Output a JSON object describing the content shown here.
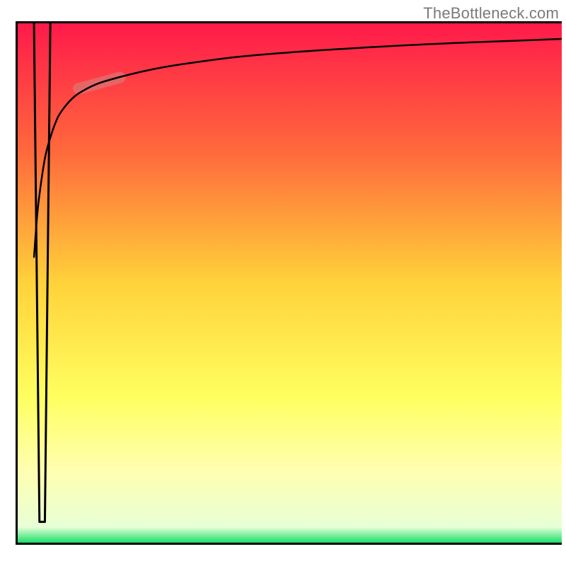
{
  "attribution": "TheBottleneck.com",
  "chart_data": {
    "type": "line",
    "title": "",
    "xlabel": "",
    "ylabel": "",
    "x_range": [
      0,
      100
    ],
    "y_range": [
      0,
      100
    ],
    "axes_visible": false,
    "grid": false,
    "background_gradient": {
      "type": "vertical",
      "stops": [
        {
          "t": 0.0,
          "color": "#ff1a4a"
        },
        {
          "t": 0.25,
          "color": "#ff6a3c"
        },
        {
          "t": 0.5,
          "color": "#ffd23a"
        },
        {
          "t": 0.72,
          "color": "#ffff60"
        },
        {
          "t": 0.86,
          "color": "#ffffb0"
        },
        {
          "t": 0.97,
          "color": "#e8ffd6"
        },
        {
          "t": 1.0,
          "color": "#19e06a"
        }
      ]
    },
    "series": [
      {
        "name": "dip",
        "color": "#000000",
        "width": 3,
        "x": [
          3,
          4,
          5,
          6
        ],
        "y": [
          100,
          4,
          4,
          100
        ]
      },
      {
        "name": "main-curve",
        "color": "#000000",
        "width": 2.5,
        "x": [
          3,
          3.5,
          4,
          5,
          6,
          7,
          8,
          10,
          12,
          15,
          20,
          25,
          30,
          40,
          50,
          60,
          70,
          80,
          90,
          100
        ],
        "y": [
          55,
          62,
          67,
          74,
          78,
          81,
          83,
          85.5,
          87,
          88.5,
          90,
          91.2,
          92.1,
          93.5,
          94.4,
          95.1,
          95.7,
          96.2,
          96.6,
          97
        ]
      }
    ],
    "annotations": [
      {
        "name": "highlight-capsule",
        "type": "capsule",
        "x_center": 15,
        "y_center": 88.5,
        "length": 10,
        "thickness": 22,
        "angle_deg": -16,
        "color": "#d28582",
        "opacity": 0.55
      }
    ]
  }
}
